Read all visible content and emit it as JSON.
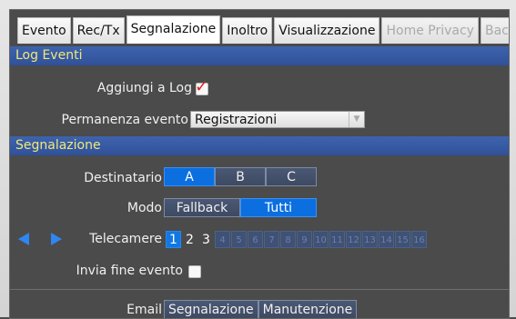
{
  "tabs": [
    {
      "label": "Evento",
      "state": "normal"
    },
    {
      "label": "Rec/Tx",
      "state": "normal"
    },
    {
      "label": "Segnalazione",
      "state": "active"
    },
    {
      "label": "Inoltro",
      "state": "normal"
    },
    {
      "label": "Visualizzazione",
      "state": "normal"
    },
    {
      "label": "Home Privacy",
      "state": "disabled"
    },
    {
      "label": "Backup",
      "state": "disabled"
    }
  ],
  "log_eventi": {
    "header": "Log Eventi",
    "aggiungi_label": "Aggiungi a Log",
    "aggiungi_checked": true,
    "checkmark": "✓",
    "permanenza_label": "Permanenza evento",
    "permanenza_value": "Registrazioni",
    "dropdown_arrow": "▼"
  },
  "segnalazione": {
    "header": "Segnalazione",
    "destinatario_label": "Destinatario",
    "destinatario_options": [
      "A",
      "B",
      "C"
    ],
    "destinatario_selected": "A",
    "modo_label": "Modo",
    "modo_options": [
      "Fallback",
      "Tutti"
    ],
    "modo_selected": "Tutti",
    "telecamere_label": "Telecamere",
    "telecamere": [
      "1",
      "2",
      "3",
      "4",
      "5",
      "6",
      "7",
      "8",
      "9",
      "10",
      "11",
      "12",
      "13",
      "14",
      "15",
      "16"
    ],
    "telecamere_selected": [
      "1"
    ],
    "telecamere_available": [
      "1",
      "2",
      "3"
    ],
    "invia_fine_label": "Invia fine evento",
    "invia_fine_checked": false,
    "email_label": "Email",
    "email_buttons": [
      "Segnalazione",
      "Manutenzione"
    ]
  },
  "colors": {
    "accent": "#0b6fe0",
    "header_bg": "#3457a2",
    "header_text": "#f1e878",
    "panel_bg": "#4b4b4b",
    "check_red": "#e51d1d"
  }
}
